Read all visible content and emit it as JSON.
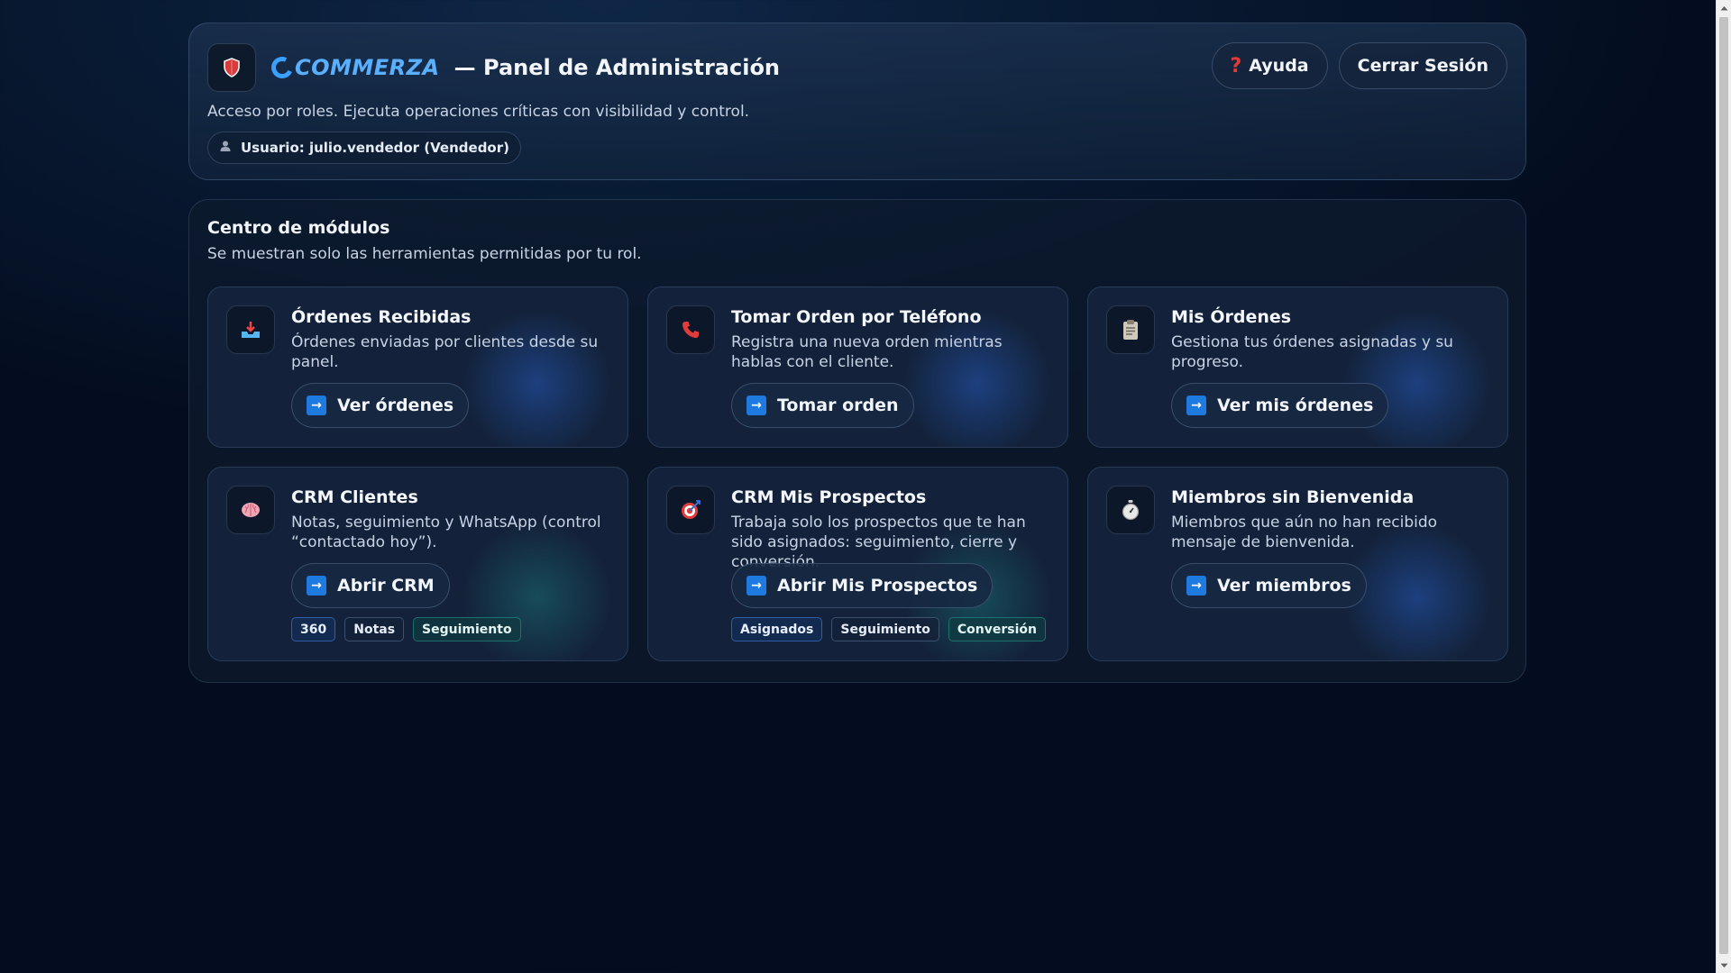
{
  "header": {
    "shield_icon": "shield-icon",
    "brand_letter": "C",
    "brand_name": "COMMERZA",
    "title": "— Panel de Administración",
    "subtitle": "Acceso por roles. Ejecuta operaciones críticas con visibilidad y control.",
    "user_label": "Usuario: julio.vendedor (Vendedor)",
    "help_label": "Ayuda",
    "logout_label": "Cerrar Sesión",
    "accent": "#3aa0ff"
  },
  "modules": {
    "title": "Centro de módulos",
    "subtitle": "Se muestran solo las herramientas permitidas por tu rol.",
    "items": [
      {
        "icon": "inbox-tray-icon",
        "title": "Órdenes Recibidas",
        "desc": "Órdenes enviadas por clientes desde su panel.",
        "button": "Ver órdenes"
      },
      {
        "icon": "phone-icon",
        "title": "Tomar Orden por Teléfono",
        "desc": "Registra una nueva orden mientras hablas con el cliente.",
        "button": "Tomar orden"
      },
      {
        "icon": "clipboard-icon",
        "title": "Mis Órdenes",
        "desc": "Gestiona tus órdenes asignadas y su progreso.",
        "button": "Ver mis órdenes"
      },
      {
        "icon": "brain-icon",
        "title": "CRM Clientes",
        "desc": "Notas, seguimiento y WhatsApp (control “contactado hoy”).",
        "button": "Abrir CRM",
        "chips": [
          "360",
          "Notas",
          "Seguimiento"
        ]
      },
      {
        "icon": "target-icon",
        "title": "CRM Mis Prospectos",
        "desc": "Trabaja solo los prospectos que te han sido asignados: seguimiento, cierre y conversión.",
        "button": "Abrir Mis Prospectos",
        "chips": [
          "Asignados",
          "Seguimiento",
          "Conversión"
        ]
      },
      {
        "icon": "stopwatch-icon",
        "title": "Miembros sin Bienvenida",
        "desc": "Miembros que aún no han recibido mensaje de bienvenida.",
        "button": "Ver miembros"
      }
    ]
  }
}
